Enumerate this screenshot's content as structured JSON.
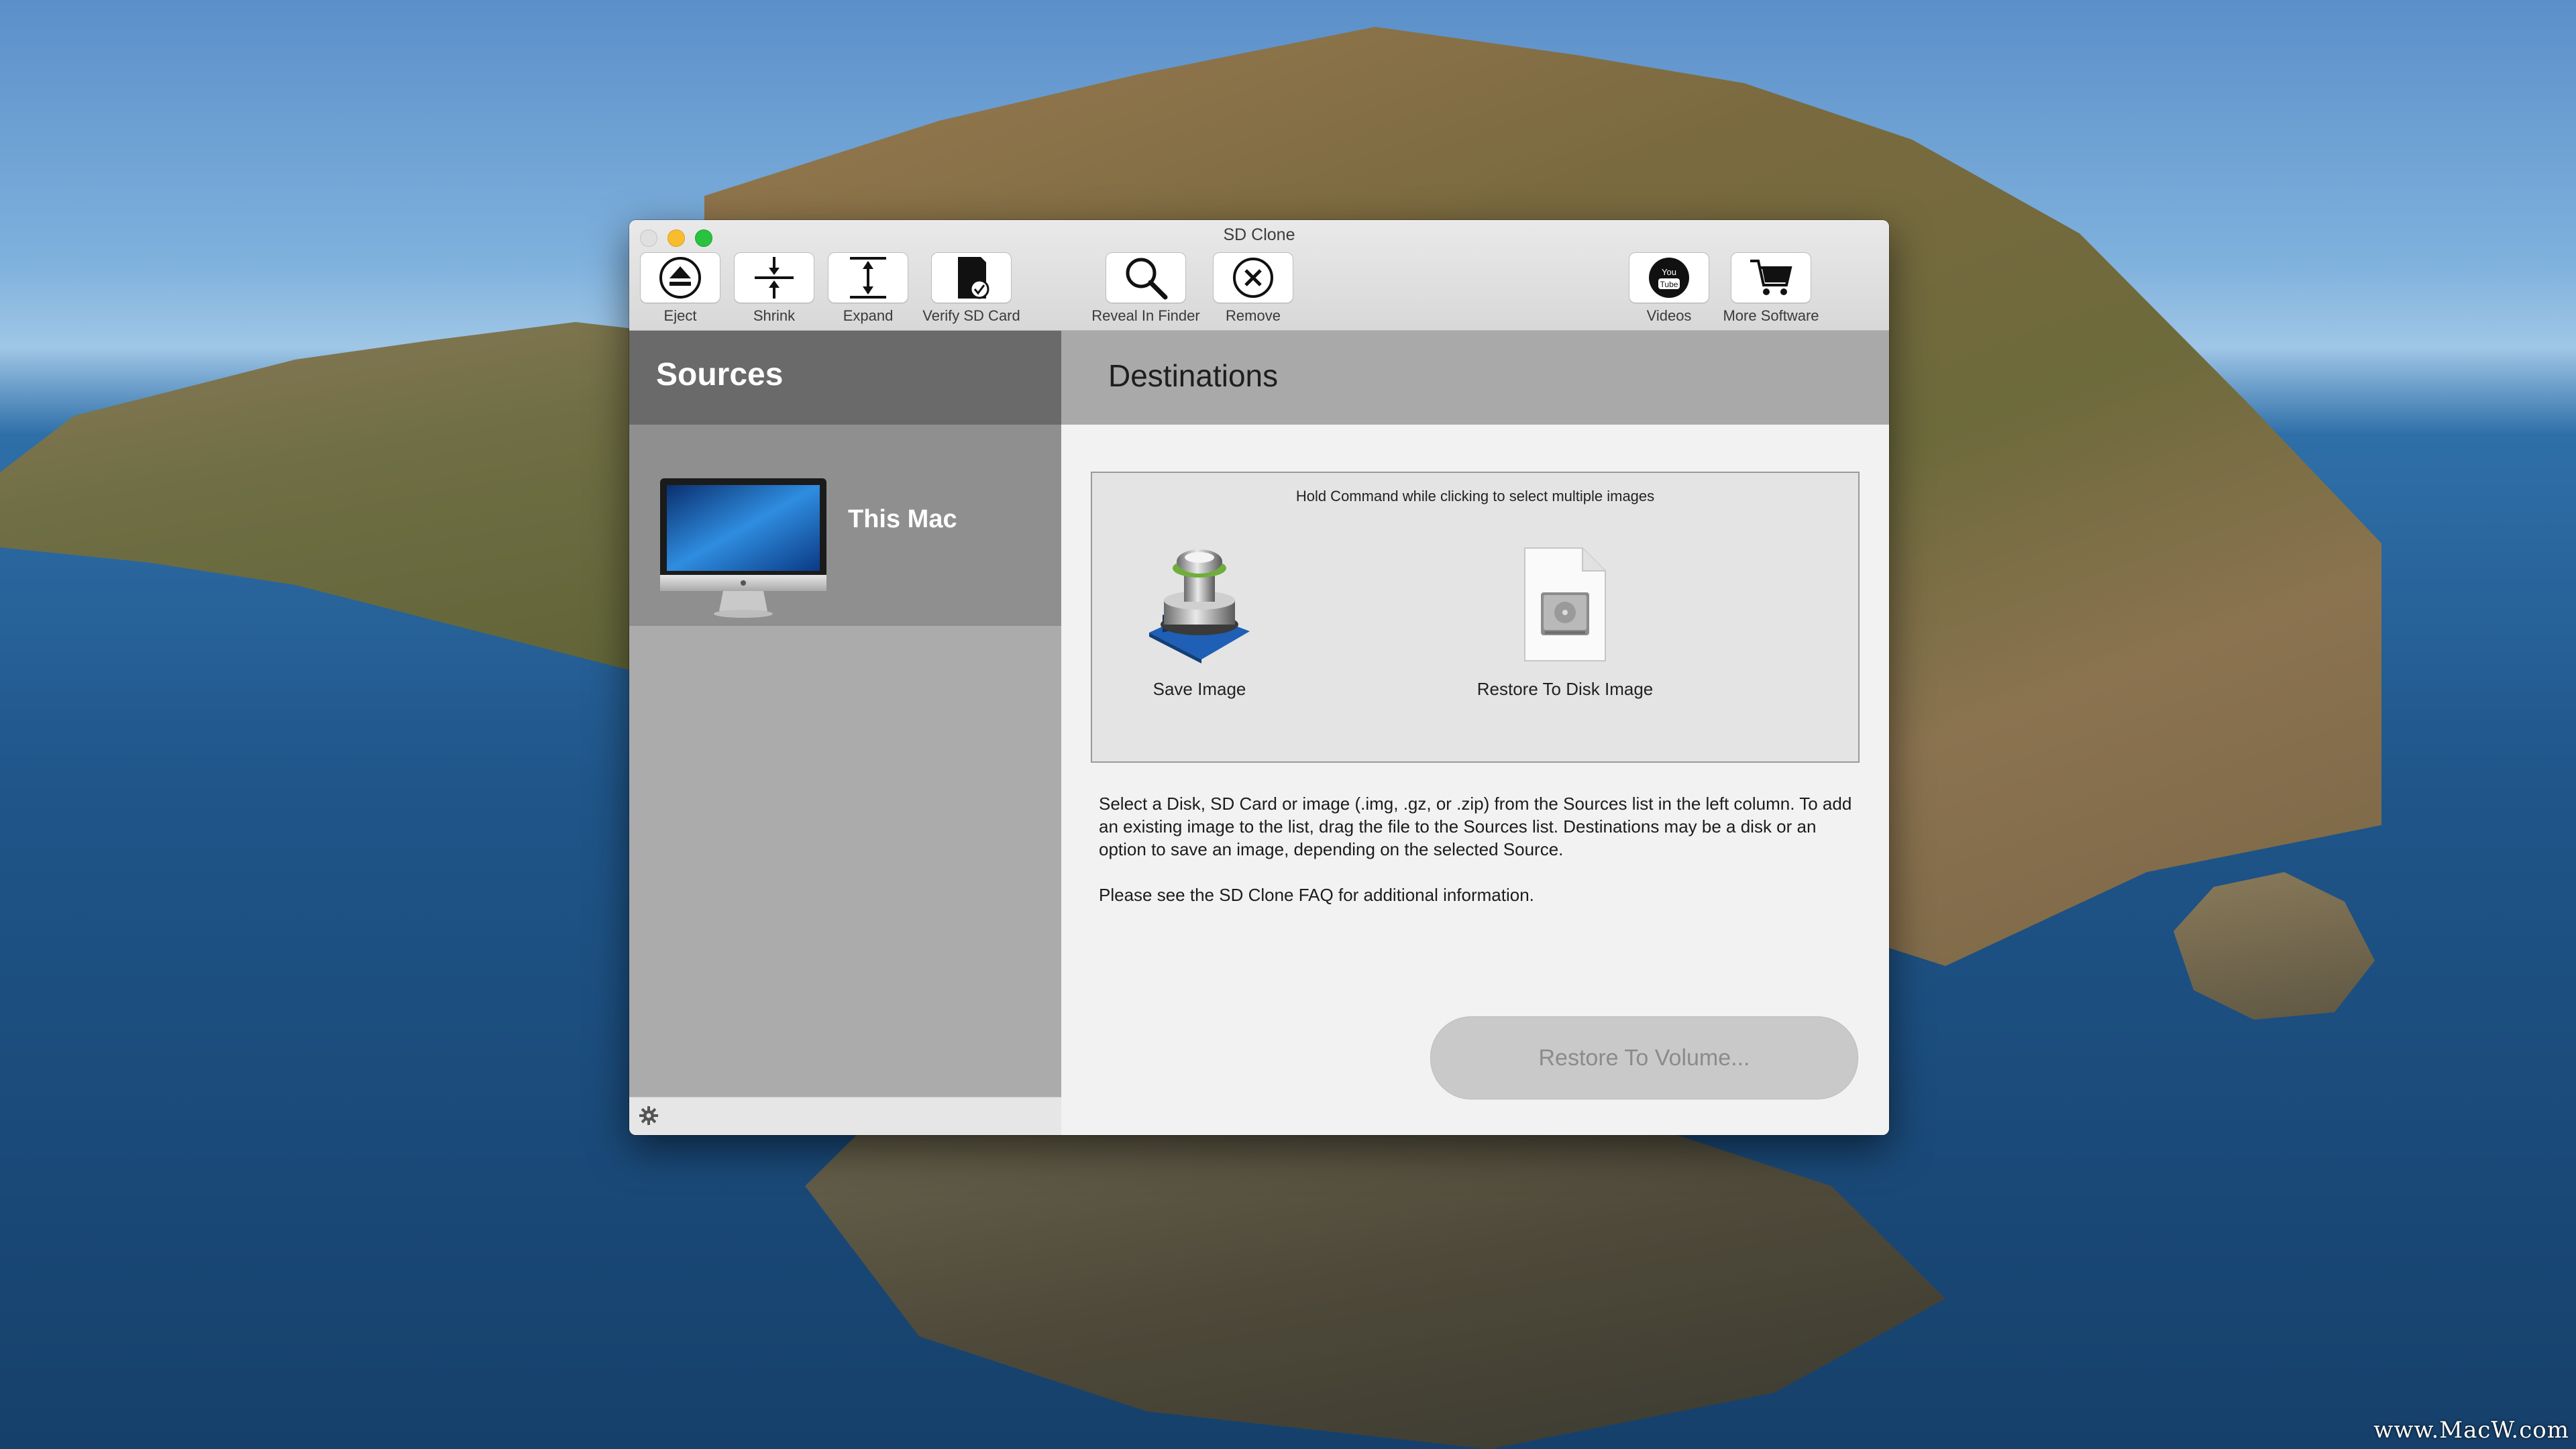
{
  "window": {
    "title": "SD Clone"
  },
  "toolbar": {
    "eject": "Eject",
    "shrink": "Shrink",
    "expand": "Expand",
    "verify": "Verify SD Card",
    "reveal": "Reveal In Finder",
    "remove": "Remove",
    "videos": "Videos",
    "more_software": "More Software",
    "videos_icon_text_1": "You",
    "videos_icon_text_2": "Tube"
  },
  "sources": {
    "header": "Sources",
    "items": [
      {
        "label": "This Mac"
      }
    ]
  },
  "destinations": {
    "header": "Destinations",
    "hint": "Hold Command while clicking to select multiple images",
    "items": [
      {
        "label": "Save Image"
      },
      {
        "label": "Restore To Disk Image"
      }
    ],
    "description_1": "Select a Disk, SD Card or image (.img, .gz, or .zip) from the Sources list in the left column. To add an existing image to the list, drag the file to the Sources list.  Destinations may be a disk or an option to save an image, depending on the selected Source.",
    "description_2": "Please see the SD Clone FAQ for additional information.",
    "restore_button": "Restore To Volume..."
  },
  "desktop": {
    "watermark": "www.MacW.com"
  },
  "colors": {
    "sources_header": "#6a6a6a",
    "destinations_header": "#a9a9a9",
    "close": "#e0e0e0",
    "minimize": "#f7bd2e",
    "maximize": "#29c33f"
  }
}
